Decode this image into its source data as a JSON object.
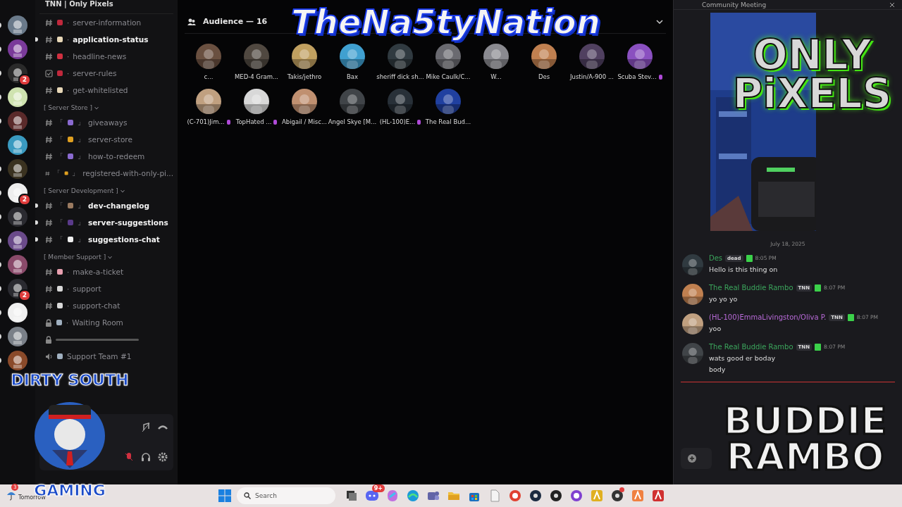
{
  "servers": [
    {
      "color": "#6a7a8a",
      "unread": true
    },
    {
      "color": "#7a3a9a",
      "unread": true
    },
    {
      "color": "#2a2a2a",
      "unread": true,
      "badge": "2"
    },
    {
      "color": "#cfe3b0",
      "unread": true
    },
    {
      "color": "#5a2a2a",
      "unread": true
    },
    {
      "color": "#3a9ac0",
      "unread": false
    },
    {
      "color": "#3a3220",
      "unread": true
    },
    {
      "color": "#eeeeee",
      "unread": true,
      "badge": "2"
    },
    {
      "color": "#2a2a30",
      "unread": true
    },
    {
      "color": "#6a4a8a",
      "unread": true
    },
    {
      "color": "#8a4a6a",
      "unread": true
    },
    {
      "color": "#2a2a30",
      "unread": true,
      "badge": "2"
    },
    {
      "color": "#f0f0f0",
      "unread": true
    },
    {
      "color": "#7a8088",
      "unread": true
    },
    {
      "color": "#8a4a2a",
      "unread": true
    }
  ],
  "server_name": "TNN | Only Pixels",
  "channel_groups": [
    {
      "channels": [
        {
          "kind": "text",
          "color": "#c0283c",
          "before": "·",
          "name": "server-information",
          "unread": false
        },
        {
          "kind": "text",
          "color": "#e8d8b8",
          "before": "·",
          "name": "application-status",
          "unread": true
        },
        {
          "kind": "text",
          "color": "#d03040",
          "before": "·",
          "name": "headline-news",
          "unread": false
        },
        {
          "kind": "rules",
          "color": "#c0283c",
          "before": "·",
          "name": "server-rules",
          "unread": false
        },
        {
          "kind": "text",
          "color": "#e8d8b8",
          "before": "·",
          "name": "get-whitelisted",
          "unread": false
        }
      ]
    },
    {
      "category": "[ Server Store ]",
      "channels": [
        {
          "kind": "text",
          "color": "#8a6ad0",
          "before": "「",
          "after": "」",
          "name": "giveaways",
          "unread": false
        },
        {
          "kind": "text",
          "color": "#e0a020",
          "before": "「",
          "after": "」",
          "name": "server-store",
          "unread": false
        },
        {
          "kind": "text",
          "color": "#8a6ad0",
          "before": "「",
          "after": "」",
          "name": "how-to-redeem",
          "unread": false
        },
        {
          "kind": "text",
          "color": "#e0a020",
          "before": "「",
          "after": "」",
          "name": "registered-with-only-pi...",
          "unread": false
        }
      ]
    },
    {
      "category": "[ Server Development ]",
      "channels": [
        {
          "kind": "text",
          "color": "#9a7a60",
          "before": "「",
          "after": "」",
          "name": "dev-changelog",
          "unread": true
        },
        {
          "kind": "text",
          "color": "#5a3a8a",
          "before": "「",
          "after": "」",
          "name": "server-suggestions",
          "unread": true
        },
        {
          "kind": "text",
          "color": "#f0f0f0",
          "before": "「",
          "after": "」",
          "name": "suggestions-chat",
          "unread": true
        }
      ]
    },
    {
      "category": "[ Member Support ]",
      "channels": [
        {
          "kind": "text",
          "color": "#e8a0b0",
          "before": "·",
          "name": "make-a-ticket",
          "unread": false
        },
        {
          "kind": "text",
          "color": "#d8d8d8",
          "before": "·",
          "name": "support",
          "unread": false
        },
        {
          "kind": "text",
          "color": "#d8d8d8",
          "before": "·",
          "name": "support-chat",
          "unread": false
        },
        {
          "kind": "locked",
          "color": "#a0b0c0",
          "before": "·",
          "name": "Waiting Room",
          "unread": false
        },
        {
          "kind": "redacted"
        },
        {
          "kind": "voice",
          "color": "#a0b0c0",
          "name": "Support Team #1",
          "unread": false
        }
      ]
    }
  ],
  "voice_controls": {
    "deafen_muted": true
  },
  "audience": {
    "title": "Audience — 16",
    "members": [
      {
        "name": "c...",
        "boost": false
      },
      {
        "name": "MED-4 Gram...",
        "boost": false
      },
      {
        "name": "Takis/jethro",
        "boost": false
      },
      {
        "name": "Bax",
        "boost": false
      },
      {
        "name": "sheriff dick sh...",
        "boost": false
      },
      {
        "name": "Mike Caulk/C...",
        "boost": false
      },
      {
        "name": "W...",
        "boost": false
      },
      {
        "name": "Des",
        "boost": false
      },
      {
        "name": "Justin/A-900 ...",
        "boost": false
      },
      {
        "name": "Scuba Stev...",
        "boost": true
      },
      {
        "name": "(C-701)Jim...",
        "boost": true
      },
      {
        "name": "TopHated ...",
        "boost": true
      },
      {
        "name": "Abigail / Misc...",
        "boost": false
      },
      {
        "name": "Angel Skye [M...",
        "boost": false
      },
      {
        "name": "(HL-100)E...",
        "boost": true
      },
      {
        "name": "The Real Bud...",
        "boost": false
      }
    ]
  },
  "chat": {
    "title": "Community Meeting",
    "date": "July 18, 2025",
    "messages": [
      {
        "author": "Des",
        "color": "#3ba55c",
        "tag": "dead",
        "time": "8:05 PM",
        "lines": [
          "Hello is this thing on"
        ]
      },
      {
        "author": "The Real Buddie Rambo",
        "color": "#3ba55c",
        "tag": "TNN",
        "time": "8:07 PM",
        "lines": [
          "yo yo yo"
        ]
      },
      {
        "author": "(HL-100)EmmaLivingston/Oliva P.",
        "color": "#b86ad8",
        "tag": "TNN",
        "time": "8:07 PM",
        "lines": [
          "yoo"
        ]
      },
      {
        "author": "The Real Buddie Rambo",
        "color": "#3ba55c",
        "tag": "TNN",
        "time": "8:07 PM",
        "lines": [
          "wats good er boday",
          "body"
        ]
      }
    ]
  },
  "taskbar": {
    "weather_badge": "3",
    "weather_text": "Tomorrow",
    "search_placeholder": "Search",
    "apps": [
      {
        "kind": "square",
        "color": "#333333",
        "alert": false
      },
      {
        "kind": "bubble",
        "color": "#5865f2",
        "badge": "9+",
        "alert": false
      },
      {
        "kind": "blob",
        "color": "#c070e0",
        "alert": false
      },
      {
        "kind": "wave",
        "color": "#1a9ad8",
        "alert": false
      },
      {
        "kind": "people",
        "color": "#6264a7",
        "alert": false
      },
      {
        "kind": "folder",
        "color": "#f0c040",
        "alert": false
      },
      {
        "kind": "bag",
        "color": "#1a70c0",
        "alert": false
      },
      {
        "kind": "page",
        "color": "#f4f4f4",
        "alert": false
      },
      {
        "kind": "ring",
        "color": "#e04030",
        "alert": false
      },
      {
        "kind": "disc",
        "color": "#1a2a40",
        "alert": false
      },
      {
        "kind": "disc",
        "color": "#222222",
        "alert": false
      },
      {
        "kind": "ring",
        "color": "#8040d0",
        "alert": false
      },
      {
        "kind": "tile",
        "color": "#e0b020",
        "alert": false
      },
      {
        "kind": "disc",
        "color": "#333333",
        "alert": true
      },
      {
        "kind": "tile",
        "color": "#f08040",
        "alert": false
      },
      {
        "kind": "tile",
        "color": "#d03030",
        "alert": false
      }
    ]
  },
  "overlays": [
    {
      "kind": "banner",
      "lines": [
        "TheNa5tyNation"
      ]
    },
    {
      "kind": "green",
      "lines": [
        "ONLY",
        "PiXELS"
      ]
    },
    {
      "kind": "skull",
      "lines": [
        "DIRTY SOUTH",
        "GAMING"
      ]
    },
    {
      "kind": "bubble",
      "lines": [
        "BUDDIE",
        "RAMBO"
      ]
    }
  ]
}
